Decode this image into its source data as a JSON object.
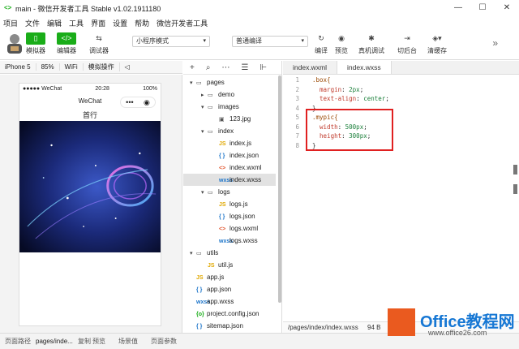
{
  "window": {
    "title": "main - 微信开发者工具 Stable v1.02.1911180",
    "controls": [
      "—",
      "☐",
      "✕"
    ]
  },
  "menu": [
    "项目",
    "文件",
    "编辑",
    "工具",
    "界面",
    "设置",
    "帮助",
    "微信开发者工具"
  ],
  "toolbar": {
    "simulator": "模拟器",
    "editor": "编辑器",
    "debugger": "调试器",
    "mode_select": "小程序模式",
    "compile_select": "普通编译",
    "compile": "编译",
    "preview": "预览",
    "real_debug": "真机调试",
    "backend": "切后台",
    "clear_cache": "清缓存"
  },
  "subbar": {
    "device": "iPhone 5",
    "zoom": "85%",
    "network": "WiFi",
    "ops": "模拟操作"
  },
  "phone": {
    "signal": "●●●●● WeChat",
    "time": "20:28",
    "battery": "100%",
    "nav_title": "WeChat",
    "capsule_more": "•••",
    "capsule_close": "◉",
    "page_text": "首行"
  },
  "file_tree": [
    {
      "name": "pages",
      "type": "folder",
      "open": true,
      "level": 0
    },
    {
      "name": "demo",
      "type": "folder",
      "open": false,
      "level": 1
    },
    {
      "name": "images",
      "type": "folder",
      "open": true,
      "level": 1
    },
    {
      "name": "123.jpg",
      "type": "image",
      "level": 2
    },
    {
      "name": "index",
      "type": "folder",
      "open": true,
      "level": 1
    },
    {
      "name": "index.js",
      "type": "js",
      "level": 2
    },
    {
      "name": "index.json",
      "type": "json",
      "level": 2
    },
    {
      "name": "index.wxml",
      "type": "wxml",
      "level": 2
    },
    {
      "name": "index.wxss",
      "type": "wxss",
      "level": 2,
      "selected": true
    },
    {
      "name": "logs",
      "type": "folder",
      "open": true,
      "level": 1
    },
    {
      "name": "logs.js",
      "type": "js",
      "level": 2
    },
    {
      "name": "logs.json",
      "type": "json",
      "level": 2
    },
    {
      "name": "logs.wxml",
      "type": "wxml",
      "level": 2
    },
    {
      "name": "logs.wxss",
      "type": "wxss",
      "level": 2
    },
    {
      "name": "utils",
      "type": "folder",
      "open": true,
      "level": 0
    },
    {
      "name": "util.js",
      "type": "js",
      "level": 1
    },
    {
      "name": "app.js",
      "type": "js",
      "level": 0
    },
    {
      "name": "app.json",
      "type": "json",
      "level": 0
    },
    {
      "name": "app.wxss",
      "type": "wxss",
      "level": 0
    },
    {
      "name": "project.config.json",
      "type": "config",
      "level": 0
    },
    {
      "name": "sitemap.json",
      "type": "json",
      "level": 0
    }
  ],
  "editor": {
    "tabs": [
      "index.wxml",
      "index.wxss"
    ],
    "active_tab": "index.wxss",
    "lines": [
      {
        "n": "1",
        "text": ".box{",
        "kind": "sel"
      },
      {
        "n": "2",
        "text": "  margin: 2px;",
        "kind": "decl",
        "prop": "margin",
        "val": "2px"
      },
      {
        "n": "3",
        "text": "  text-align: center;",
        "kind": "decl",
        "prop": "text-align",
        "val": "center"
      },
      {
        "n": "4",
        "text": "}",
        "kind": "brace"
      },
      {
        "n": "5",
        "text": ".mypic{",
        "kind": "sel"
      },
      {
        "n": "6",
        "text": "  width: 500px;",
        "kind": "decl",
        "prop": "width",
        "val": "500px"
      },
      {
        "n": "7",
        "text": "  height: 300px;",
        "kind": "decl",
        "prop": "height",
        "val": "300px"
      },
      {
        "n": "8",
        "text": "}",
        "kind": "brace"
      }
    ],
    "status_path": "/pages/index/index.wxss",
    "status_size": "94 B"
  },
  "bottom": {
    "path_label": "页面路径",
    "path": "pages/inde...",
    "copy": "复制",
    "preview": "预览",
    "scene": "场景值",
    "params": "页面参数"
  },
  "watermark": {
    "title": "Office教程网",
    "url": "www.office26.com"
  },
  "colors": {
    "accent_green": "#1aad19",
    "highlight_red": "#e02020"
  }
}
